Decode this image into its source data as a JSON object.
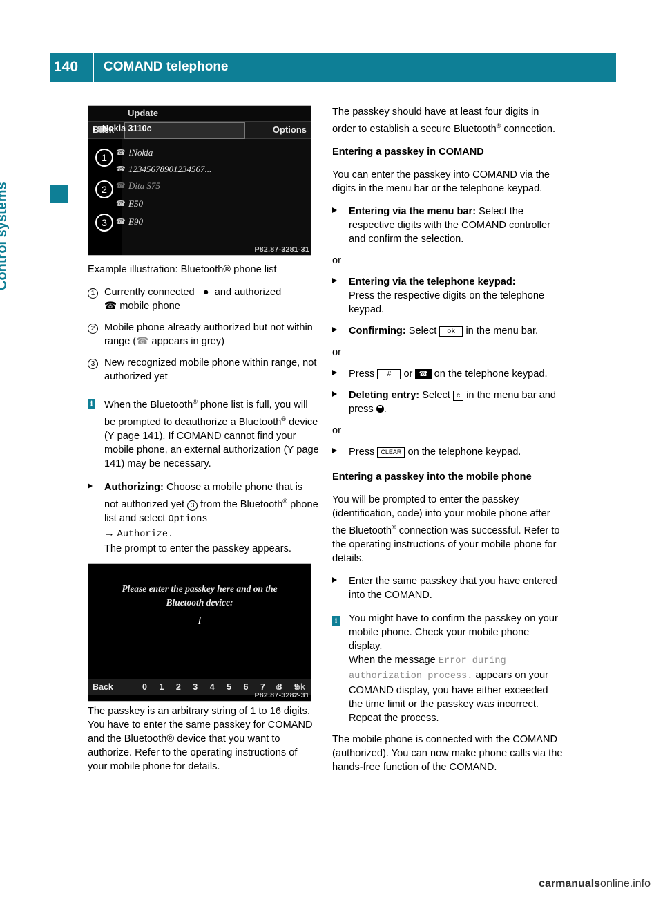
{
  "header": {
    "page_number": "140",
    "title": "COMAND telephone"
  },
  "side_tab": {
    "label": "Control systems"
  },
  "screenshot1": {
    "code": "P82.87-3281-31",
    "title": "Update",
    "menu_back": "Back",
    "menu_options": "Options",
    "selected_entry": "Nokia 3110c",
    "list": [
      "!Nokia",
      "12345678901234567...",
      "Dita S75",
      "E50",
      "E90"
    ],
    "numbers": [
      "1",
      "2",
      "3"
    ]
  },
  "screenshot2": {
    "code": "P82.87-3282-31",
    "line1": "Please enter the passkey here and on the",
    "line2": "Bluetooth device:",
    "cursor": "I",
    "bar_back": "Back",
    "bar_digits": "0 1 2 3 4 5 6 7 8 9",
    "bar_c": "c",
    "bar_ok": "ok"
  },
  "left": {
    "caption": "Example illustration: Bluetooth® phone list",
    "item1": "Currently connected",
    "item1_mid": "and authorized",
    "item1_line2": "mobile phone",
    "item2": "Mobile phone already authorized but not within range (",
    "item2_end": "appears in grey)",
    "item3": "New recognized mobile phone within range, not authorized yet",
    "note1_a": "When the Bluetooth",
    "note1_b": " phone list is full, you will be prompted to deauthorize a Bluetooth",
    "note1_c": " device (",
    "note1_page1": "page 141",
    "note1_d": "). If COMAND cannot find your mobile phone, an external authorization (",
    "note1_page2": "page 141",
    "note1_e": ") may be necessary.",
    "auth_label": "Authorizing:",
    "auth_text": "Choose a mobile phone that is not authorized yet",
    "auth_text2": "from the Bluetooth",
    "auth_text3": "phone list and select",
    "auth_options": "Options",
    "auth_arrow": "→",
    "auth_authorize": "Authorize.",
    "auth_prompt": "The prompt to enter the passkey appears.",
    "passkey_para": "The passkey is an arbitrary string of 1 to 16 digits. You have to enter the same passkey for COMAND and the Bluetooth® device that you want to authorize. Refer to the operating instructions of your mobile phone for details."
  },
  "right": {
    "intro_a": "The passkey should have at least four digits in order to establish a secure Bluetooth",
    "intro_b": " connection.",
    "head1": "Entering a passkey in COMAND",
    "p1": "You can enter the passkey into COMAND via the digits in the menu bar or the telephone keypad.",
    "b1_label": "Entering via the menu bar:",
    "b1_text": "Select the respective digits with the COMAND controller and confirm the selection.",
    "or1": "or",
    "b2_label": "Entering via the telephone keypad:",
    "b2_text": "Press the respective digits on the telephone keypad.",
    "b3_label": "Confirming:",
    "b3_text": "Select",
    "b3_key": "ok",
    "b3_text2": "in the menu bar.",
    "or2": "or",
    "b4_text": "Press",
    "b4_key1": "#",
    "b4_or": "or",
    "b4_text2": "on the telephone keypad.",
    "b5_label": "Deleting entry:",
    "b5_text": "Select",
    "b5_key": "c",
    "b5_text2": "in the menu bar and press",
    "b5_end": ".",
    "or3": "or",
    "b6_text": "Press",
    "b6_key": "CLEAR",
    "b6_text2": "on the telephone keypad.",
    "head2": "Entering a passkey into the mobile phone",
    "p2_a": "You will be prompted to enter the passkey (identification, code) into your mobile phone after the Bluetooth",
    "p2_b": " connection was successful. Refer to the operating instructions of your mobile phone for details.",
    "b7_text": "Enter the same passkey that you have entered into the COMAND.",
    "note2_a": "You might have to confirm the passkey on your mobile phone. Check your mobile phone display.",
    "note2_b": "When the message",
    "note2_msg1": "Error during",
    "note2_msg2": "authorization process.",
    "note2_c": "appears on your COMAND display, you have either exceeded the time limit or the passkey was incorrect. Repeat the process.",
    "p3": "The mobile phone is connected with the COMAND (authorized). You can now make phone calls via the hands-free function of the COMAND."
  },
  "footer": {
    "bold": "carmanuals",
    "rest": "online.info"
  }
}
